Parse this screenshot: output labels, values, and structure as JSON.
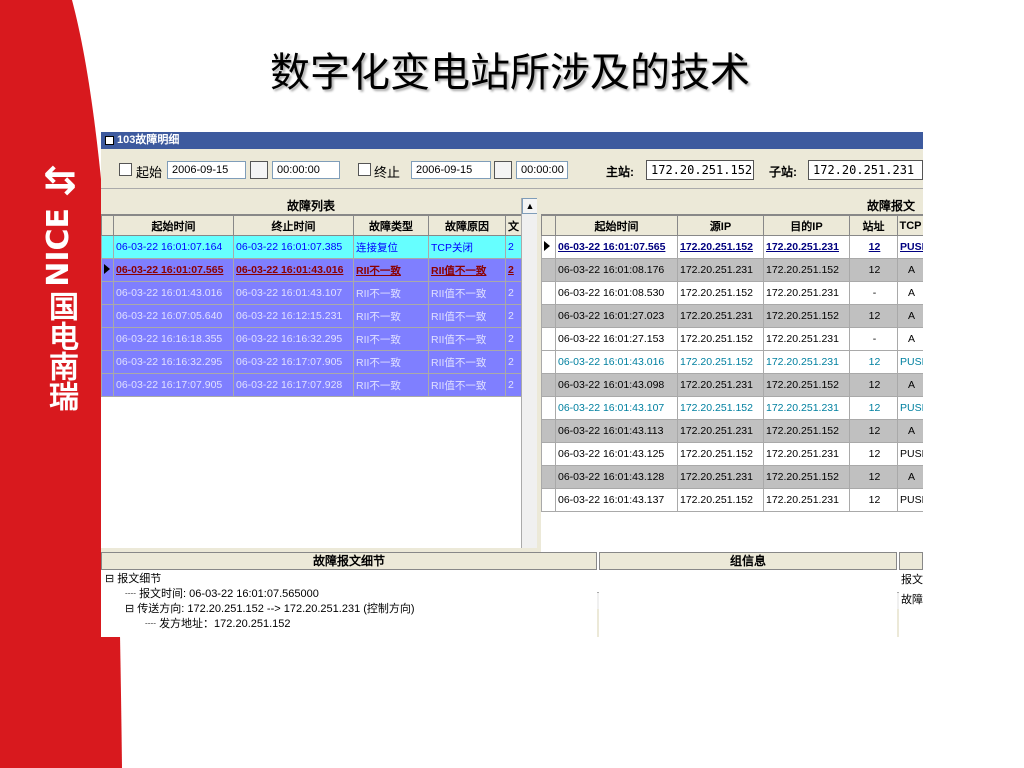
{
  "slide": {
    "title": "数字化变电站所涉及的技术",
    "logo_text": "NICE",
    "logo_cn": "国电南瑞"
  },
  "app": {
    "window_title": "103故障明细",
    "filter": {
      "start_label": "起始",
      "start_date": "2006-09-15",
      "start_time": "00:00:00",
      "end_label": "终止",
      "end_date": "2006-09-15",
      "end_time": "00:00:00",
      "master_label": "主站:",
      "master_value": "172.20.251.152",
      "sub_label": "子站:",
      "sub_value": "172.20.251.231"
    },
    "fault_list": {
      "title": "故障列表",
      "columns": [
        "起始时间",
        "终止时间",
        "故障类型",
        "故障原因",
        "文"
      ],
      "rows": [
        [
          "06-03-22 16:01:07.164",
          "06-03-22 16:01:07.385",
          "连接复位",
          "TCP关闭",
          "2"
        ],
        [
          "06-03-22 16:01:07.565",
          "06-03-22 16:01:43.016",
          "RII不一致",
          "RII值不一致",
          "2"
        ],
        [
          "06-03-22 16:01:43.016",
          "06-03-22 16:01:43.107",
          "RII不一致",
          "RII值不一致",
          "2"
        ],
        [
          "06-03-22 16:07:05.640",
          "06-03-22 16:12:15.231",
          "RII不一致",
          "RII值不一致",
          "2"
        ],
        [
          "06-03-22 16:16:18.355",
          "06-03-22 16:16:32.295",
          "RII不一致",
          "RII值不一致",
          "2"
        ],
        [
          "06-03-22 16:16:32.295",
          "06-03-22 16:17:07.905",
          "RII不一致",
          "RII值不一致",
          "2"
        ],
        [
          "06-03-22 16:17:07.905",
          "06-03-22 16:17:07.928",
          "RII不一致",
          "RII值不一致",
          "2"
        ]
      ]
    },
    "fault_msgs": {
      "title": "故障报文",
      "columns": [
        "起始时间",
        "源IP",
        "目的IP",
        "站址",
        "TCP"
      ],
      "rows": [
        [
          "06-03-22 16:01:07.565",
          "172.20.251.152",
          "172.20.251.231",
          "12",
          "PUSH"
        ],
        [
          "06-03-22 16:01:08.176",
          "172.20.251.231",
          "172.20.251.152",
          "12",
          "A"
        ],
        [
          "06-03-22 16:01:08.530",
          "172.20.251.152",
          "172.20.251.231",
          "-",
          "A"
        ],
        [
          "06-03-22 16:01:27.023",
          "172.20.251.231",
          "172.20.251.152",
          "12",
          "A"
        ],
        [
          "06-03-22 16:01:27.153",
          "172.20.251.152",
          "172.20.251.231",
          "-",
          "A"
        ],
        [
          "06-03-22 16:01:43.016",
          "172.20.251.152",
          "172.20.251.231",
          "12",
          "PUSH"
        ],
        [
          "06-03-22 16:01:43.098",
          "172.20.251.231",
          "172.20.251.152",
          "12",
          "A"
        ],
        [
          "06-03-22 16:01:43.107",
          "172.20.251.152",
          "172.20.251.231",
          "12",
          "PUSH"
        ],
        [
          "06-03-22 16:01:43.113",
          "172.20.251.231",
          "172.20.251.152",
          "12",
          "A"
        ],
        [
          "06-03-22 16:01:43.125",
          "172.20.251.152",
          "172.20.251.231",
          "12",
          "PUSH"
        ],
        [
          "06-03-22 16:01:43.128",
          "172.20.251.231",
          "172.20.251.152",
          "12",
          "A"
        ],
        [
          "06-03-22 16:01:43.137",
          "172.20.251.152",
          "172.20.251.231",
          "12",
          "PUSH"
        ]
      ]
    },
    "detail": {
      "title": "故障报文细节",
      "tree": [
        "报文细节",
        "报文时间: 06-03-22 16:01:07.565000",
        "传送方向: 172.20.251.152 --> 172.20.251.231 (控制方向)",
        "发方地址：172.20.251.152"
      ]
    },
    "group": {
      "title": "组信息",
      "col_a": "报文",
      "col_b": "故障"
    }
  }
}
